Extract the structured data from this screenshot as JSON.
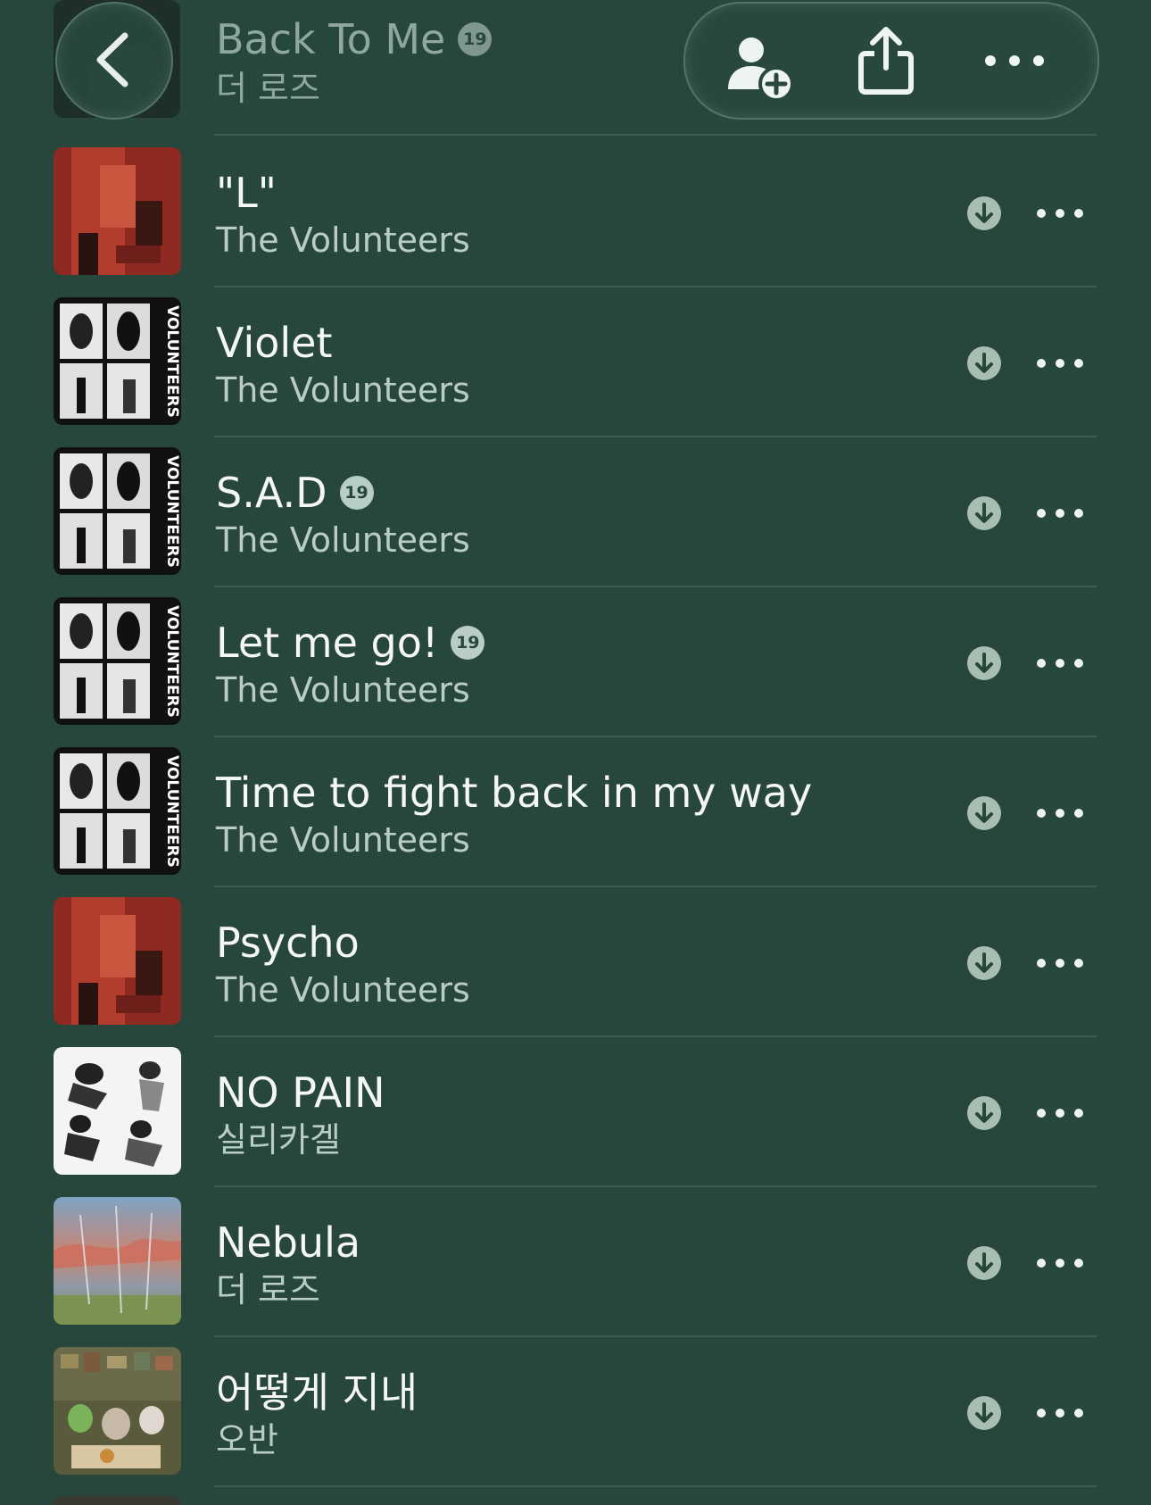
{
  "header": {
    "title": "Back To Me",
    "badge": "19",
    "artist": "더 로즈",
    "actions": [
      "add-person",
      "share",
      "more"
    ]
  },
  "songs": [
    {
      "title": "\"L\"",
      "artist": "The Volunteers",
      "explicit": "",
      "art": "red"
    },
    {
      "title": "Violet",
      "artist": "The Volunteers",
      "explicit": "",
      "art": "grid"
    },
    {
      "title": "S.A.D",
      "artist": "The Volunteers",
      "explicit": "19",
      "art": "grid"
    },
    {
      "title": "Let me go!",
      "artist": "The Volunteers",
      "explicit": "19",
      "art": "grid"
    },
    {
      "title": "Time to fight back in my way",
      "artist": "The Volunteers",
      "explicit": "",
      "art": "grid"
    },
    {
      "title": "Psycho",
      "artist": "The Volunteers",
      "explicit": "",
      "art": "red"
    },
    {
      "title": "NO PAIN",
      "artist": "실리카겔",
      "explicit": "",
      "art": "white"
    },
    {
      "title": "Nebula",
      "artist": "더 로즈",
      "explicit": "",
      "art": "sky"
    },
    {
      "title": "어떻게 지내",
      "artist": "오반",
      "explicit": "",
      "art": "room"
    }
  ],
  "art_labels": {
    "grid": "VOLUNTEERS"
  },
  "colors": {
    "background": "#27473c",
    "secondary_text": "#b9cdc4",
    "separator": "#3d5c51"
  }
}
